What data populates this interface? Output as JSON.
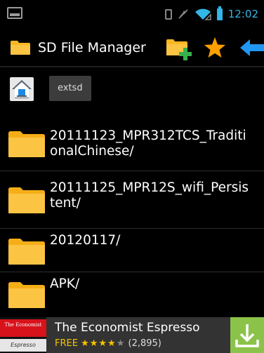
{
  "status_bar": {
    "time": "12:02",
    "icons": [
      "image-notification-icon",
      "sim-icon",
      "mute-icon",
      "wifi-icon",
      "battery-icon"
    ]
  },
  "action_bar": {
    "title": "SD File Manager",
    "icons": [
      "folder-icon",
      "new-folder-icon",
      "star-icon",
      "back-arrow-icon"
    ]
  },
  "path_bar": {
    "home_icon": "home-icon",
    "crumb": "extsd"
  },
  "files": [
    {
      "name": "20111123_MPR312TCS_Traditi\nonalChinese/",
      "icon": "folder-icon"
    },
    {
      "name": "20111125_MPR12S_wifi_Persis\ntent/",
      "icon": "folder-icon"
    },
    {
      "name": "20120117/",
      "icon": "folder-icon"
    },
    {
      "name": "APK/",
      "icon": "folder-icon"
    }
  ],
  "ad": {
    "logo_top": "The Economist",
    "logo_bottom": "Espresso",
    "title": "The Economist Espresso",
    "free_label": "FREE",
    "stars": "★★★★★",
    "rating_count": "(2,895)",
    "rating": 4.5
  },
  "colors": {
    "accent": "#33b5e5",
    "folder": "#f9b722",
    "ad_green": "#8bc34a",
    "economist_red": "#d8121b"
  }
}
